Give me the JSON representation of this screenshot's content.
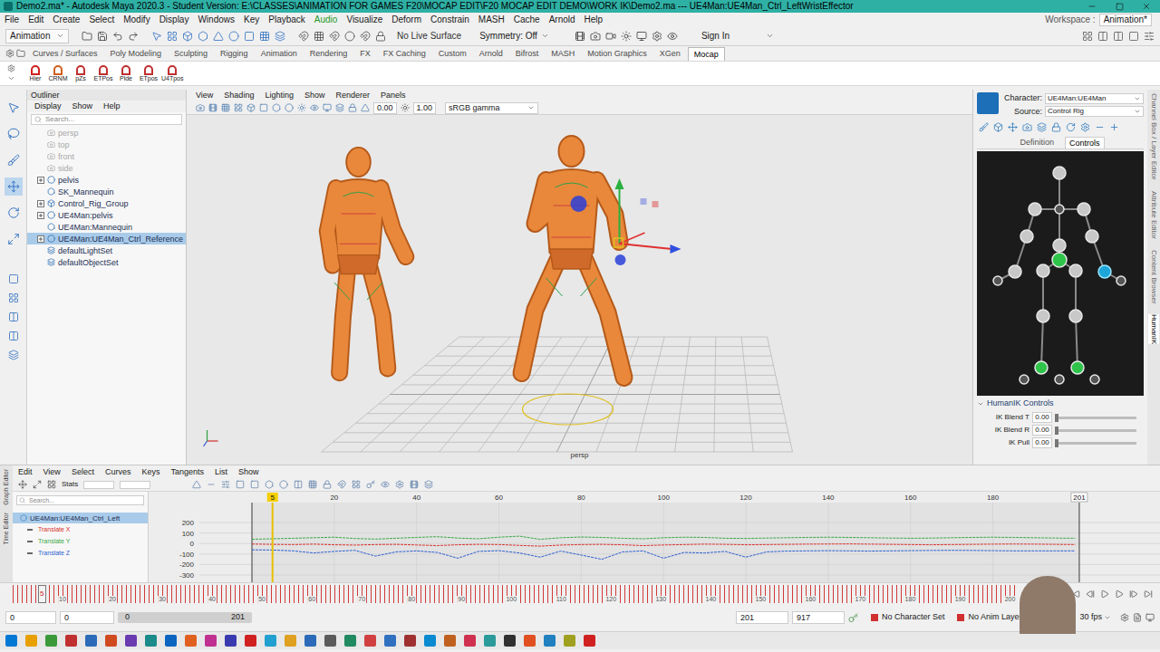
{
  "window": {
    "title": "Demo2.ma* - Autodesk Maya 2020.3 - Student Version: E:\\CLASSES\\ANIMATION FOR GAMES F20\\MOCAP EDIT\\F20 MOCAP EDIT DEMO\\WORK IK\\Demo2.ma  ---  UE4Man:UE4Man_Ctrl_LeftWristEffector"
  },
  "menu_bar": {
    "items": [
      {
        "label": "File",
        "highlighted": false
      },
      {
        "label": "Edit",
        "highlighted": false
      },
      {
        "label": "Create",
        "highlighted": false
      },
      {
        "label": "Select",
        "highlighted": false
      },
      {
        "label": "Modify",
        "highlighted": false
      },
      {
        "label": "Display",
        "highlighted": false
      },
      {
        "label": "Windows",
        "highlighted": false
      },
      {
        "label": "Key",
        "highlighted": false
      },
      {
        "label": "Playback",
        "highlighted": false
      },
      {
        "label": "Audio",
        "highlighted": true
      },
      {
        "label": "Visualize",
        "highlighted": false
      },
      {
        "label": "Deform",
        "highlighted": false
      },
      {
        "label": "Constrain",
        "highlighted": false
      },
      {
        "label": "MASH",
        "highlighted": false
      },
      {
        "label": "Cache",
        "highlighted": false
      },
      {
        "label": "Arnold",
        "highlighted": false
      },
      {
        "label": "Help",
        "highlighted": false
      }
    ],
    "workspace_label": "Workspace :",
    "workspace": "Animation*"
  },
  "status_line": {
    "mode": "Animation",
    "live_surface": "No Live Surface",
    "symmetry": "Symmetry: Off",
    "sign_in": "Sign In"
  },
  "shelf": {
    "tabs": [
      {
        "label": "Curves / Surfaces",
        "selected": false
      },
      {
        "label": "Poly Modeling",
        "selected": false
      },
      {
        "label": "Sculpting",
        "selected": false
      },
      {
        "label": "Rigging",
        "selected": false
      },
      {
        "label": "Animation",
        "selected": false
      },
      {
        "label": "Rendering",
        "selected": false
      },
      {
        "label": "FX",
        "selected": false
      },
      {
        "label": "FX Caching",
        "selected": false
      },
      {
        "label": "Custom",
        "selected": false
      },
      {
        "label": "Arnold",
        "selected": false
      },
      {
        "label": "Bifrost",
        "selected": false
      },
      {
        "label": "MASH",
        "selected": false
      },
      {
        "label": "Motion Graphics",
        "selected": false
      },
      {
        "label": "XGen",
        "selected": false
      },
      {
        "label": "Mocap",
        "selected": true
      }
    ],
    "buttons": [
      "Hier",
      "CRNM",
      "pZs",
      "ETPos",
      "Plde",
      "ETpos",
      "U4Tpos"
    ]
  },
  "outliner": {
    "title": "Outliner",
    "menus": [
      "Display",
      "Show",
      "Help"
    ],
    "search_placeholder": "Search...",
    "items": [
      {
        "label": "persp",
        "kind": "camera",
        "dimmed": true,
        "expandable": false,
        "selected": false
      },
      {
        "label": "top",
        "kind": "camera",
        "dimmed": true,
        "expandable": false,
        "selected": false
      },
      {
        "label": "front",
        "kind": "camera",
        "dimmed": true,
        "expandable": false,
        "selected": false
      },
      {
        "label": "side",
        "kind": "camera",
        "dimmed": true,
        "expandable": false,
        "selected": false
      },
      {
        "label": "pelvis",
        "kind": "joint",
        "dimmed": false,
        "expandable": true,
        "selected": false
      },
      {
        "label": "SK_Mannequin",
        "kind": "mesh",
        "dimmed": false,
        "expandable": false,
        "selected": false
      },
      {
        "label": "Control_Rig_Group",
        "kind": "group",
        "dimmed": false,
        "expandable": true,
        "selected": false
      },
      {
        "label": "UE4Man:pelvis",
        "kind": "joint",
        "dimmed": false,
        "expandable": true,
        "selected": false
      },
      {
        "label": "UE4Man:Mannequin",
        "kind": "mesh",
        "dimmed": false,
        "expandable": false,
        "selected": false
      },
      {
        "label": "UE4Man:UE4Man_Ctrl_Reference",
        "kind": "joint",
        "dimmed": false,
        "expandable": true,
        "selected": true
      },
      {
        "label": "defaultLightSet",
        "kind": "set",
        "dimmed": false,
        "expandable": false,
        "selected": false
      },
      {
        "label": "defaultObjectSet",
        "kind": "set",
        "dimmed": false,
        "expandable": false,
        "selected": false
      }
    ]
  },
  "viewport": {
    "menus": [
      "View",
      "Shading",
      "Lighting",
      "Show",
      "Renderer",
      "Panels"
    ],
    "exposure": "0.00",
    "gamma": "1.00",
    "color_space": "sRGB gamma",
    "camera": "persp"
  },
  "humanik": {
    "character_label": "Character:",
    "character": "UE4Man:UE4Man",
    "source_label": "Source:",
    "source": "Control Rig",
    "tabs": [
      {
        "label": "Definition",
        "selected": false
      },
      {
        "label": "Controls",
        "selected": true
      }
    ],
    "effectors": [
      {
        "pinned": false,
        "selected": false
      },
      {
        "pinned": false,
        "selected": false
      },
      {
        "pinned": false,
        "selected": false
      },
      {
        "pinned": false,
        "selected": false
      },
      {
        "pinned": false,
        "selected": false
      },
      {
        "pinned": false,
        "selected": false
      },
      {
        "pinned": false,
        "selected": false
      },
      {
        "pinned": true,
        "selected": false
      },
      {
        "pinned": false,
        "selected": false
      },
      {
        "pinned": false,
        "selected": true
      },
      {
        "pinned": false,
        "selected": false
      },
      {
        "pinned": false,
        "selected": false
      },
      {
        "pinned": false,
        "selected": false
      },
      {
        "pinned": false,
        "selected": false
      },
      {
        "pinned": true,
        "selected": false
      },
      {
        "pinned": true,
        "selected": false
      },
      {
        "pinned": false,
        "selected": false
      },
      {
        "pinned": false,
        "selected": false
      },
      {
        "pinned": false,
        "selected": false
      },
      {
        "pinned": false,
        "selected": false
      },
      {
        "pinned": false,
        "selected": false
      }
    ],
    "controls_header": "HumanIK Controls",
    "sliders": [
      {
        "label": "IK Blend T",
        "value": "0.00",
        "level": 0
      },
      {
        "label": "IK Blend R",
        "value": "0.00",
        "level": 0
      },
      {
        "label": "IK Pull",
        "value": "0.00",
        "level": 0
      }
    ]
  },
  "side_tabs": [
    {
      "label": "Channel Box / Layer Editor",
      "selected": false
    },
    {
      "label": "Attribute Editor",
      "selected": false
    },
    {
      "label": "Content Browser",
      "selected": false
    },
    {
      "label": "HumanIK",
      "selected": true
    }
  ],
  "graph_editor": {
    "side_labels": [
      "Graph Editor",
      "Time Editor"
    ],
    "menus": [
      "Edit",
      "View",
      "Select",
      "Curves",
      "Keys",
      "Tangents",
      "List",
      "Show"
    ],
    "stats": "Stats",
    "search_placeholder": "Search...",
    "node": {
      "label": "UE4Man:UE4Man_Ctrl_Left",
      "selected": true
    },
    "channels": [
      {
        "label": "Translate X",
        "color": "#d9302c",
        "values": [
          -5,
          -8,
          -10,
          -6,
          -12,
          -15,
          -10,
          -8,
          -14,
          -20,
          -12,
          -8,
          -10,
          -18,
          -25,
          -15,
          -10,
          -8,
          -12,
          -20,
          -14,
          -10,
          -6,
          -8,
          -12,
          -10,
          -8,
          -6,
          -5,
          -4,
          -6,
          -8,
          -10,
          -12,
          -10,
          -8,
          -6,
          -5,
          -6,
          -8,
          -10
        ]
      },
      {
        "label": "Translate Y",
        "color": "#3aa845",
        "values": [
          40,
          45,
          50,
          55,
          60,
          48,
          42,
          50,
          58,
          65,
          52,
          45,
          60,
          70,
          40,
          55,
          62,
          58,
          50,
          45,
          55,
          60,
          58,
          50,
          48,
          52,
          55,
          58,
          60,
          58,
          55,
          52,
          50,
          52,
          55,
          58,
          60,
          58,
          55,
          52,
          50
        ]
      },
      {
        "label": "Translate Z",
        "color": "#2f5fd0",
        "values": [
          -60,
          -62,
          -70,
          -90,
          -75,
          -65,
          -120,
          -80,
          -70,
          -85,
          -140,
          -75,
          -68,
          -90,
          -130,
          -72,
          -110,
          -150,
          -80,
          -70,
          -140,
          -85,
          -90,
          -75,
          -130,
          -80,
          -72,
          -70,
          -68,
          -70,
          -72,
          -70,
          -68,
          -66,
          -65,
          -66,
          -68,
          -70,
          -70,
          -70,
          -70
        ]
      }
    ],
    "y_ticks": [
      "200",
      "100",
      "0",
      "-100",
      "-200",
      "-300"
    ],
    "x_ticks": [
      "20",
      "40",
      "60",
      "80",
      "100",
      "120",
      "140",
      "160",
      "180"
    ],
    "end_label": "201",
    "current_label": "5"
  },
  "time_slider": {
    "ticks": [
      "10",
      "20",
      "30",
      "40",
      "50",
      "60",
      "70",
      "80",
      "90",
      "100",
      "110",
      "120",
      "130",
      "140",
      "150",
      "160",
      "170",
      "180",
      "190",
      "200"
    ],
    "current_frame": "5",
    "level": 0.025,
    "frame_field": "5"
  },
  "range_slider": {
    "start": "0",
    "playback_start": "0",
    "bar_start": "0",
    "bar_end": "201",
    "playback_end": "201",
    "end": "917",
    "character_set": "No Character Set",
    "anim_layer": "No Anim Layer",
    "fps": "30 fps"
  }
}
